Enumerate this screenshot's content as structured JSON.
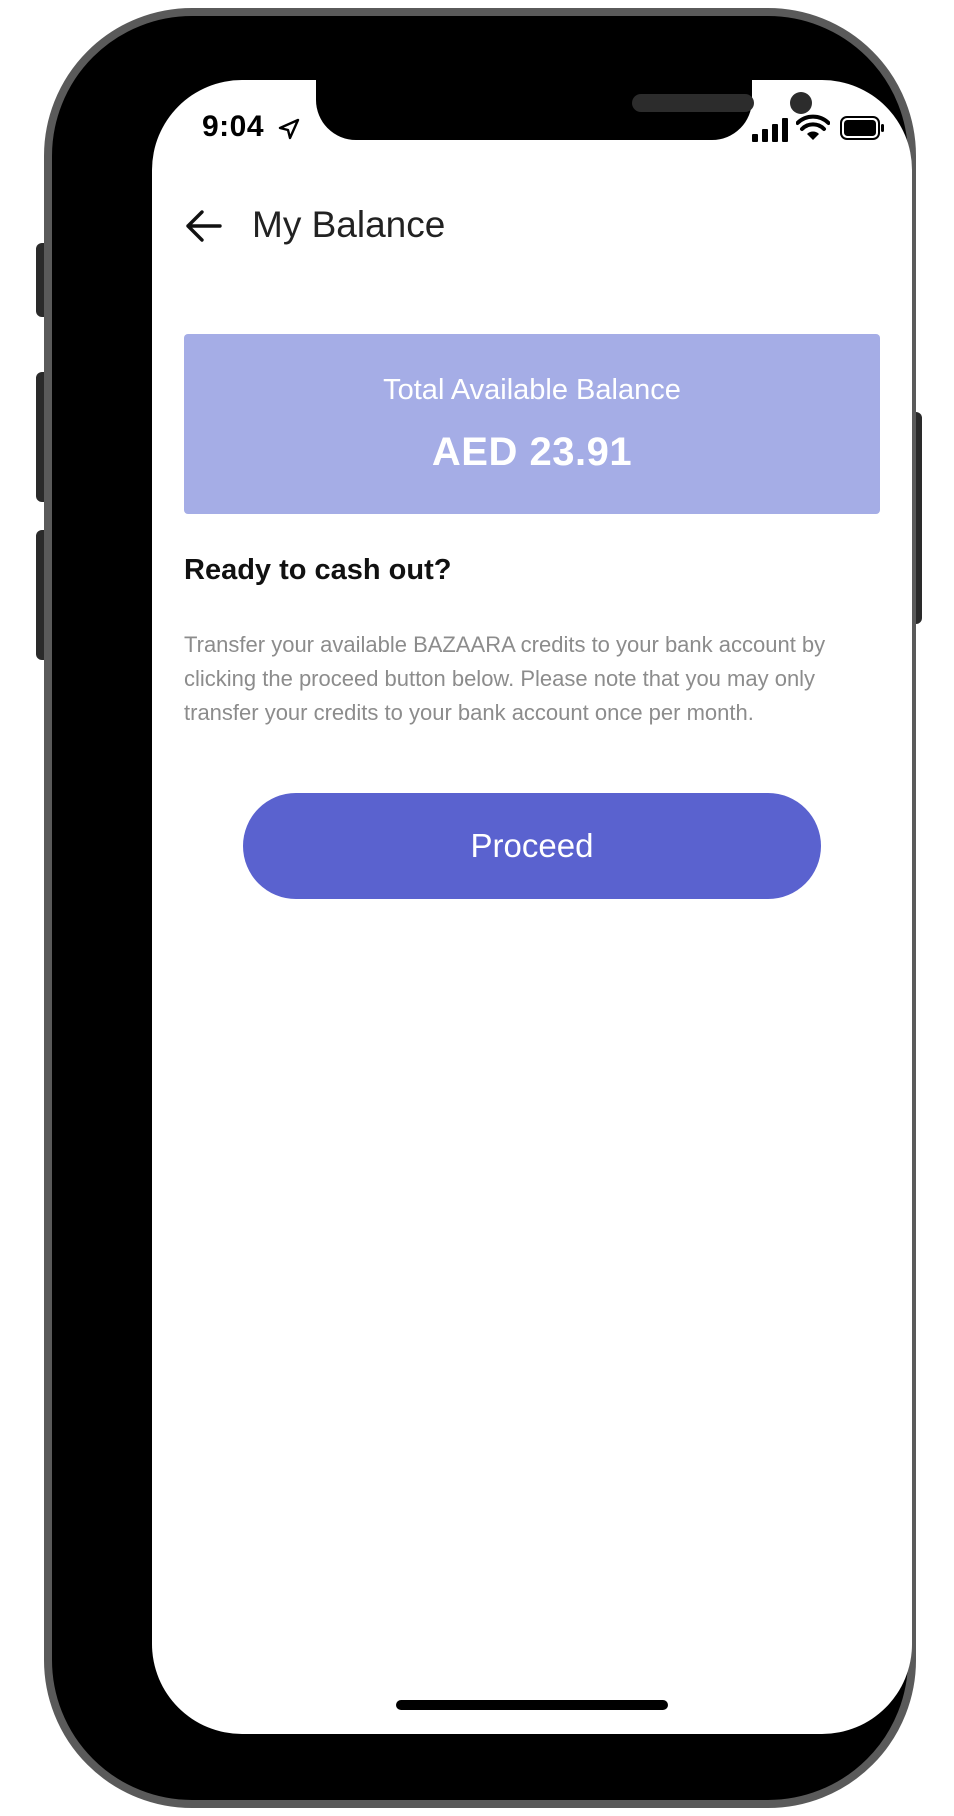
{
  "status_bar": {
    "time": "9:04"
  },
  "header": {
    "title": "My Balance"
  },
  "balance_card": {
    "label": "Total Available Balance",
    "amount": "AED 23.91"
  },
  "cash_out": {
    "heading": "Ready to cash out?",
    "description": "Transfer your available BAZAARA credits to your bank account by clicking the proceed button below. Please note that you may only transfer your credits to your bank account once per month.",
    "button_label": "Proceed"
  },
  "icons": {
    "back": "arrow-left-icon",
    "location": "location-arrow-icon",
    "signal": "cellular-signal-icon",
    "wifi": "wifi-icon",
    "battery": "battery-icon"
  },
  "colors": {
    "accent": "#5a62cf",
    "card_background": "#a5ade6",
    "body_text": "#8c8c8c"
  }
}
